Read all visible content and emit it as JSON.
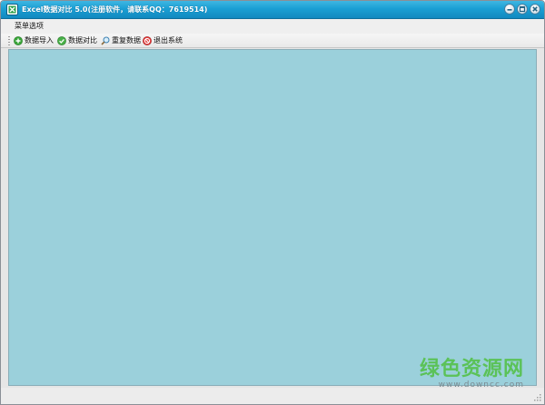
{
  "window": {
    "title": "Excel数据对比 5.0(注册软件，请联系QQ：7619514)"
  },
  "menu": {
    "items": [
      {
        "label": "菜单选项"
      }
    ]
  },
  "toolbar": {
    "buttons": [
      {
        "label": "数据导入",
        "icon": "green-plus-icon"
      },
      {
        "label": "数据对比",
        "icon": "green-check-icon"
      },
      {
        "label": "重复数据",
        "icon": "magnifier-icon"
      },
      {
        "label": "退出系统",
        "icon": "red-stop-icon"
      }
    ]
  },
  "content": {
    "background": "#9bd0db"
  },
  "watermark": {
    "main": "绿色资源网",
    "sub": "www.downcc.com"
  },
  "colors": {
    "titlebar": "#1a9fd4",
    "content": "#9bd0db",
    "watermark": "#55c14a"
  }
}
